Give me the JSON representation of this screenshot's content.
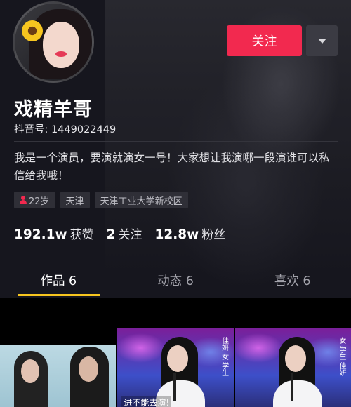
{
  "profile": {
    "name": "戏精羊哥",
    "douyin_id": "抖音号: 1449022449",
    "bio": "我是一个演员，要演就演女一号！大家想让我演哪一段演谁可以私信给我哦！",
    "avatar_icon": "avatar-photo-icon"
  },
  "actions": {
    "follow_label": "关注",
    "more_icon": "dropdown-triangle-icon",
    "accent_color": "#f2294f"
  },
  "tags": [
    {
      "label": "22岁",
      "icon": "person-icon"
    },
    {
      "label": "天津"
    },
    {
      "label": "天津工业大学新校区"
    }
  ],
  "stats": [
    {
      "num": "192.1w",
      "label": "获赞"
    },
    {
      "num": "2",
      "label": "关注"
    },
    {
      "num": "12.8w",
      "label": "粉丝"
    }
  ],
  "tabs": [
    {
      "label": "作品 6",
      "active": true
    },
    {
      "label": "动态 6",
      "active": false
    },
    {
      "label": "喜欢 6",
      "active": false
    }
  ],
  "tab_indicator_color": "#f7c51f",
  "grid": {
    "thumb2_caption": "进不能去演!",
    "thumb2_vtext": "佳妍 女 学生",
    "thumb3_vtext": "女 学生 佳妍"
  }
}
